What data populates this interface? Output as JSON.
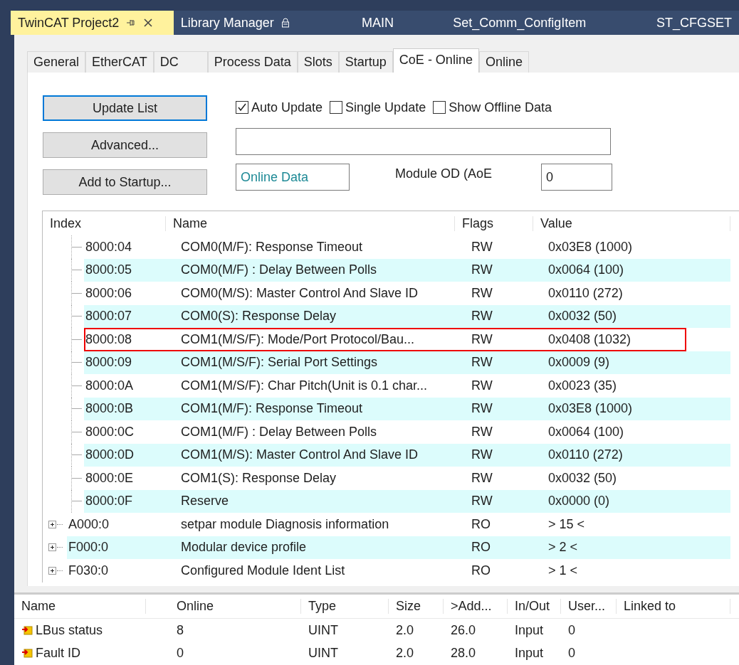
{
  "doc_tabs": [
    {
      "label": "TwinCAT Project2",
      "selected": true,
      "pinned": true,
      "closable": true,
      "locked": false
    },
    {
      "label": "Library Manager",
      "selected": false,
      "pinned": false,
      "closable": false,
      "locked": true
    },
    {
      "label": "MAIN",
      "selected": false,
      "pinned": false,
      "closable": false,
      "locked": false
    },
    {
      "label": "Set_Comm_ConfigItem",
      "selected": false,
      "pinned": false,
      "closable": false,
      "locked": false
    },
    {
      "label": "ST_CFGSET",
      "selected": false,
      "pinned": false,
      "closable": false,
      "locked": false
    }
  ],
  "tabs": [
    {
      "label": "General",
      "selected": false
    },
    {
      "label": "EtherCAT",
      "selected": false
    },
    {
      "label": "DC",
      "selected": false
    },
    {
      "label": "Process Data",
      "selected": false
    },
    {
      "label": "Slots",
      "selected": false
    },
    {
      "label": "Startup",
      "selected": false
    },
    {
      "label": "CoE - Online",
      "selected": true
    },
    {
      "label": "Online",
      "selected": false
    }
  ],
  "buttons": [
    {
      "label": "Update List",
      "focused": true
    },
    {
      "label": "Advanced...",
      "focused": false
    },
    {
      "label": "Add to Startup...",
      "focused": false
    }
  ],
  "checkboxes": [
    {
      "label": "Auto Update",
      "checked": true
    },
    {
      "label": "Single Update",
      "checked": false
    },
    {
      "label": "Show Offline Data",
      "checked": false
    }
  ],
  "data_source": "Online Data",
  "module_od": {
    "label": "Module OD (AoE",
    "value": "0"
  },
  "coe_table": {
    "columns": [
      "Index",
      "Name",
      "Flags",
      "Value"
    ],
    "rows": [
      {
        "kind": "entry",
        "index": "8000:04",
        "name": "COM0(M/F):  Response Timeout",
        "flags": "RW",
        "value": "0x03E8 (1000)",
        "highlighted": false
      },
      {
        "kind": "entry",
        "index": "8000:05",
        "name": "COM0(M/F) : Delay Between Polls",
        "flags": "RW",
        "value": "0x0064 (100)",
        "highlighted": false
      },
      {
        "kind": "entry",
        "index": "8000:06",
        "name": "COM0(M/S):  Master Control And Slave ID",
        "flags": "RW",
        "value": "0x0110 (272)",
        "highlighted": false
      },
      {
        "kind": "entry",
        "index": "8000:07",
        "name": "COM0(S):  Response Delay",
        "flags": "RW",
        "value": "0x0032 (50)",
        "highlighted": false
      },
      {
        "kind": "entry",
        "index": "8000:08",
        "name": "COM1(M/S/F):  Mode/Port Protocol/Bau...",
        "flags": "RW",
        "value": "0x0408 (1032)",
        "highlighted": true
      },
      {
        "kind": "entry",
        "index": "8000:09",
        "name": "COM1(M/S/F):  Serial Port Settings",
        "flags": "RW",
        "value": "0x0009 (9)",
        "highlighted": false
      },
      {
        "kind": "entry",
        "index": "8000:0A",
        "name": "COM1(M/S/F):  Char Pitch(Unit is 0.1 char...",
        "flags": "RW",
        "value": "0x0023 (35)",
        "highlighted": false
      },
      {
        "kind": "entry",
        "index": "8000:0B",
        "name": "COM1(M/F):  Response Timeout",
        "flags": "RW",
        "value": "0x03E8 (1000)",
        "highlighted": false
      },
      {
        "kind": "entry",
        "index": "8000:0C",
        "name": "COM1(M/F) : Delay Between Polls",
        "flags": "RW",
        "value": "0x0064 (100)",
        "highlighted": false
      },
      {
        "kind": "entry",
        "index": "8000:0D",
        "name": "COM1(M/S):  Master Control And Slave ID",
        "flags": "RW",
        "value": "0x0110 (272)",
        "highlighted": false
      },
      {
        "kind": "entry",
        "index": "8000:0E",
        "name": "COM1(S):  Response Delay",
        "flags": "RW",
        "value": "0x0032 (50)",
        "highlighted": false
      },
      {
        "kind": "entry",
        "index": "8000:0F",
        "name": "Reserve",
        "flags": "RW",
        "value": "0x0000 (0)",
        "highlighted": false
      },
      {
        "kind": "group",
        "index": "A000:0",
        "name": "setpar module Diagnosis information",
        "flags": "RO",
        "value": "> 15 <",
        "highlighted": false,
        "expanded": false
      },
      {
        "kind": "group",
        "index": "F000:0",
        "name": "Modular device profile",
        "flags": "RO",
        "value": "> 2 <",
        "highlighted": false,
        "expanded": false
      },
      {
        "kind": "group",
        "index": "F030:0",
        "name": "Configured Module Ident List",
        "flags": "RO",
        "value": "> 1 <",
        "highlighted": false,
        "expanded": false
      }
    ]
  },
  "variables_table": {
    "columns": [
      "Name",
      "",
      "Online",
      "Type",
      "Size",
      ">Add...",
      "In/Out",
      "User...",
      "Linked to"
    ],
    "rows": [
      {
        "name": "LBus status",
        "online": "8",
        "type": "UINT",
        "size": "2.0",
        "address": "26.0",
        "in_out": "Input",
        "user": "0"
      },
      {
        "name": "Fault ID",
        "online": "0",
        "type": "UINT",
        "size": "2.0",
        "address": "28.0",
        "in_out": "Input",
        "user": "0"
      }
    ]
  }
}
